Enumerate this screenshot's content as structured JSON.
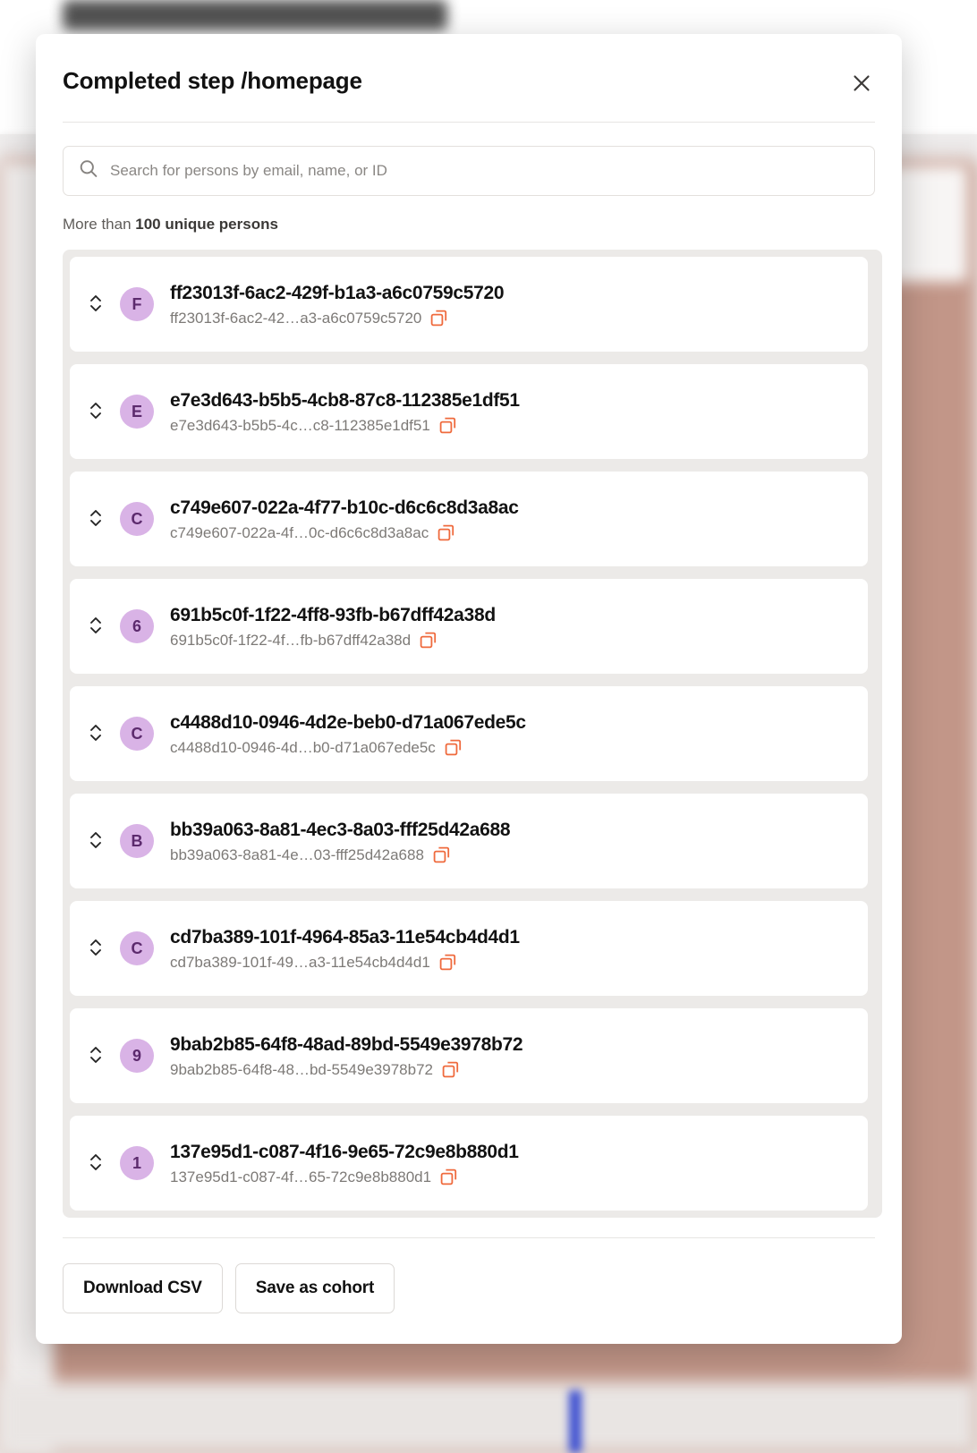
{
  "modal": {
    "title": "Completed step /homepage",
    "close_icon": "close-icon"
  },
  "search": {
    "placeholder": "Search for persons by email, name, or ID",
    "value": "",
    "icon": "search-icon"
  },
  "summary": {
    "prefix": "More than ",
    "count": "100 unique persons"
  },
  "persons": [
    {
      "initial": "F",
      "name": "ff23013f-6ac2-429f-b1a3-a6c0759c5720",
      "id_short": "ff23013f-6ac2-42…a3-a6c0759c5720"
    },
    {
      "initial": "E",
      "name": "e7e3d643-b5b5-4cb8-87c8-112385e1df51",
      "id_short": "e7e3d643-b5b5-4c…c8-112385e1df51"
    },
    {
      "initial": "C",
      "name": "c749e607-022a-4f77-b10c-d6c6c8d3a8ac",
      "id_short": "c749e607-022a-4f…0c-d6c6c8d3a8ac"
    },
    {
      "initial": "6",
      "name": "691b5c0f-1f22-4ff8-93fb-b67dff42a38d",
      "id_short": "691b5c0f-1f22-4f…fb-b67dff42a38d"
    },
    {
      "initial": "C",
      "name": "c4488d10-0946-4d2e-beb0-d71a067ede5c",
      "id_short": "c4488d10-0946-4d…b0-d71a067ede5c"
    },
    {
      "initial": "B",
      "name": "bb39a063-8a81-4ec3-8a03-fff25d42a688",
      "id_short": "bb39a063-8a81-4e…03-fff25d42a688"
    },
    {
      "initial": "C",
      "name": "cd7ba389-101f-4964-85a3-11e54cb4d4d1",
      "id_short": "cd7ba389-101f-49…a3-11e54cb4d4d1"
    },
    {
      "initial": "9",
      "name": "9bab2b85-64f8-48ad-89bd-5549e3978b72",
      "id_short": "9bab2b85-64f8-48…bd-5549e3978b72"
    },
    {
      "initial": "1",
      "name": "137e95d1-c087-4f16-9e65-72c9e8b880d1",
      "id_short": "137e95d1-c087-4f…65-72c9e8b880d1"
    }
  ],
  "footer": {
    "download_csv": "Download CSV",
    "save_as_cohort": "Save as cohort"
  },
  "colors": {
    "avatar_bg": "#d9b3e6",
    "avatar_fg": "#5c2a6d",
    "copy_icon": "#ef6a3d",
    "list_bg": "#eceae8"
  }
}
